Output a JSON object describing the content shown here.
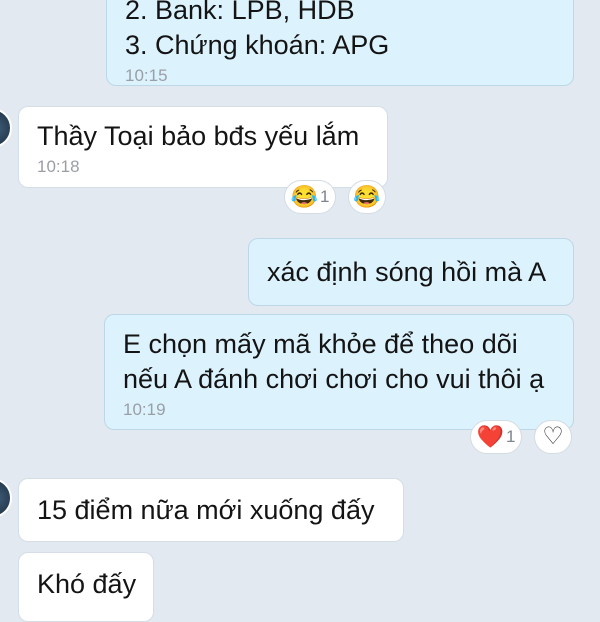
{
  "messages": [
    {
      "lines": [
        "2. Bank: LPB, HDB",
        "3. Chứng khoán: APG"
      ],
      "time": "10:15",
      "direction": "outgoing"
    },
    {
      "lines": [
        "Thầy Toại bảo bđs yếu lắm"
      ],
      "time": "10:18",
      "direction": "incoming"
    },
    {
      "lines": [
        "xác định sóng hồi mà A"
      ],
      "direction": "outgoing"
    },
    {
      "lines": [
        "E chọn mấy mã khỏe để theo dõi",
        "nếu A đánh chơi chơi cho vui thôi ạ"
      ],
      "time": "10:19",
      "direction": "outgoing"
    },
    {
      "lines": [
        "15 điểm nữa mới xuống đấy"
      ],
      "direction": "incoming"
    },
    {
      "lines": [
        "Khó đấy"
      ],
      "direction": "incoming"
    }
  ],
  "reactions": {
    "msg2": {
      "emoji": "😂",
      "count": "1"
    },
    "msg2_add": {
      "emoji": "😂"
    },
    "msg4": {
      "emoji": "❤️",
      "count": "1"
    },
    "msg4_add": {
      "emoji": "♡"
    }
  },
  "colors": {
    "background": "#e2e9f1",
    "incoming_bubble": "#ffffff",
    "outgoing_bubble": "#dcf2fd",
    "timestamp": "#9a9fa6"
  }
}
